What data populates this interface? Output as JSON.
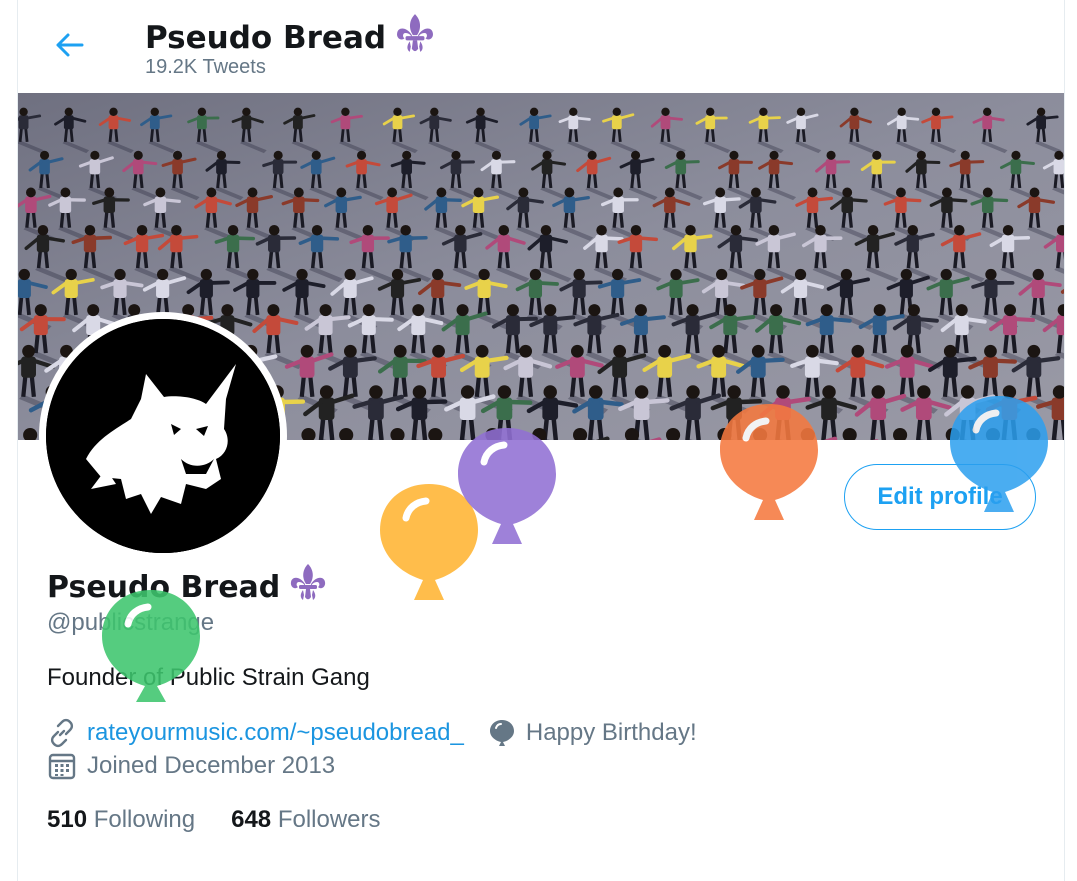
{
  "header": {
    "display_name": "Pseudo Bread",
    "tweet_count": "19.2K Tweets",
    "back_icon": "back-arrow-icon"
  },
  "profile": {
    "display_name": "Pseudo Bread",
    "handle": "@publicstrange",
    "bio": "Founder of Public Strain Gang",
    "website": "rateyourmusic.com/~pseudobread_",
    "birthday_text": "Happy Birthday!",
    "joined": "Joined December 2013",
    "following_count": "510",
    "following_label": "Following",
    "followers_count": "648",
    "followers_label": "Followers"
  },
  "actions": {
    "edit_profile": "Edit profile"
  },
  "colors": {
    "accent": "#1da1f2",
    "secondary_text": "#657786",
    "primary_text": "#14171a",
    "fleur_de_lis": "#8e6bbf"
  },
  "balloons": [
    {
      "color": "#4fcf7f",
      "name": "green"
    },
    {
      "color": "#ffbd4a",
      "name": "yellow"
    },
    {
      "color": "#9b7bd6",
      "name": "purple"
    },
    {
      "color": "#f5855a",
      "name": "orange"
    },
    {
      "color": "#39a8f0",
      "name": "blue"
    }
  ]
}
